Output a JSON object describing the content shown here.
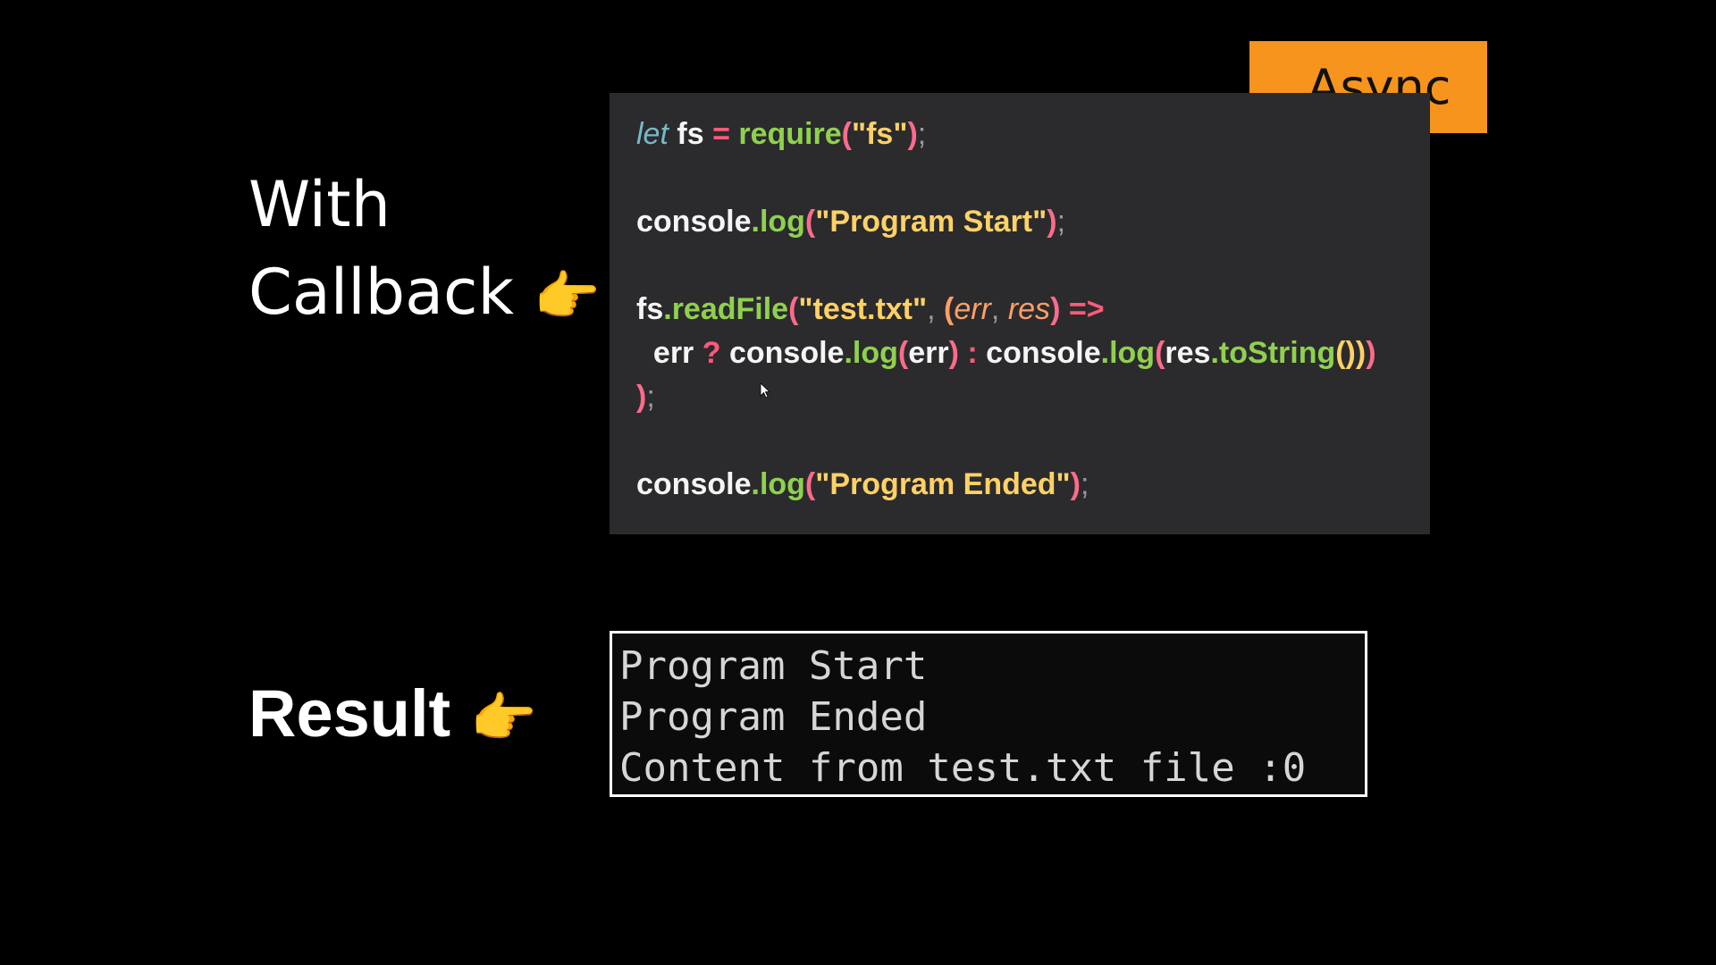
{
  "slide": {
    "heading_with": "With",
    "heading_callback": "Callback",
    "heading_result": "Result",
    "pointer_emoji": "👉",
    "badge": "Async"
  },
  "code": {
    "line1": {
      "kw": "let",
      "id": "fs",
      "op": "=",
      "fn": "require",
      "p1": "(",
      "q1": "\"",
      "s": "fs",
      "q2": "\"",
      "p2": ")",
      "semi": ";"
    },
    "line3": {
      "obj": "console",
      "dot": ".",
      "fn": "log",
      "p1": "(",
      "q1": "\"",
      "s": "Program Start",
      "q2": "\"",
      "p2": ")",
      "semi": ";"
    },
    "line5": {
      "obj": "fs",
      "dot": ".",
      "fn": "readFile",
      "p1": "(",
      "q1": "\"",
      "s": "test.txt",
      "q2": "\"",
      "comma": ", ",
      "pp1": "(",
      "a1": "err",
      "c2": ", ",
      "a2": "res",
      "pp2": ")",
      "arrow": "=>"
    },
    "line6": {
      "err": "err",
      "q": "?",
      "obj1": "console",
      "dot1": ".",
      "fn1": "log",
      "p1": "(",
      "a1": "err",
      "p2": ")",
      "colon": ":",
      "obj2": "console",
      "dot2": ".",
      "fn2": "log",
      "p3": "(",
      "a2": "res",
      "dot3": ".",
      "fn3": "toString",
      "p4": "())",
      "p5": ")"
    },
    "line7": {
      "close": ")",
      "semi": ";"
    },
    "line9": {
      "obj": "console",
      "dot": ".",
      "fn": "log",
      "p1": "(",
      "q1": "\"",
      "s": "Program Ended",
      "q2": "\"",
      "p2": ")",
      "semi": ";"
    }
  },
  "result": {
    "lines": [
      "Program Start",
      "Program Ended",
      "Content from test.txt file :0"
    ]
  },
  "colors": {
    "background": "#000000",
    "code_panel": "#2b2b2d",
    "badge": "#f7941d",
    "string": "#ffd166",
    "function": "#8fd14f",
    "operator": "#ff5a7a",
    "keyword": "#79b8c8"
  }
}
